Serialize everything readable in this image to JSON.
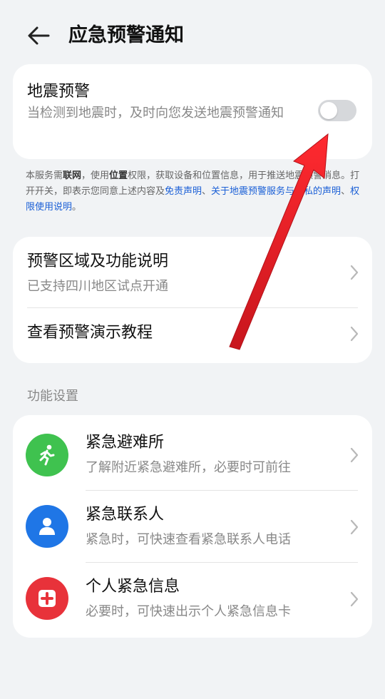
{
  "header": {
    "title": "应急预警通知",
    "back_icon": "arrow-left-icon"
  },
  "earthquake": {
    "title": "地震预警",
    "description": "当检测到地震时，及时向您发送地震预警通知",
    "toggle_on": false
  },
  "notice": {
    "part1": "本服务需",
    "bold1": "联网",
    "part2": "，使用",
    "bold2": "位置",
    "part3": "权限，获取设备和位置信息，用于推送地震预警消息。打开开关，即表示您同意上述内容及",
    "link1": "免责声明",
    "sep": "、",
    "link2": "关于地震预警服务与隐私的声明",
    "link3": "权限使用说明",
    "end": "。"
  },
  "info_list": [
    {
      "title": "预警区域及功能说明",
      "subtitle": "已支持四川地区试点开通"
    },
    {
      "title": "查看预警演示教程"
    }
  ],
  "section_label": "功能设置",
  "functions": [
    {
      "title": "紧急避难所",
      "subtitle": "了解附近紧急避难所，必要时可前往",
      "icon": "running-person-icon",
      "color": "#3fc24f"
    },
    {
      "title": "紧急联系人",
      "subtitle": "紧急时，可快速查看紧急联系人电话",
      "icon": "contact-person-icon",
      "color": "#1f76e6"
    },
    {
      "title": "个人紧急信息",
      "subtitle": "必要时，可快速出示个人紧急信息卡",
      "icon": "medical-cross-icon",
      "color": "#e8323a"
    }
  ],
  "annotation": {
    "icon": "red-pointer-arrow",
    "color": "#e3242b"
  }
}
